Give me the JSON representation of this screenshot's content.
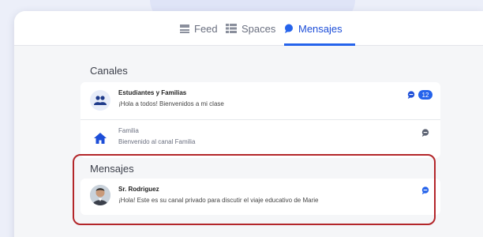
{
  "nav": {
    "tabs": [
      {
        "label": "Feed",
        "icon": "feed-icon"
      },
      {
        "label": "Spaces",
        "icon": "spaces-icon"
      },
      {
        "label": "Mensajes",
        "icon": "chat-bubble-icon",
        "active": true
      }
    ]
  },
  "channels": {
    "title": "Canales",
    "items": [
      {
        "name": "Estudiantes y Familias",
        "preview": "¡Hola a todos! Bienvenidos a mi clase",
        "unread_count": "12",
        "icon": "group-icon"
      },
      {
        "name": "Familia",
        "preview": "Bienvenido al canal Familia",
        "icon": "house-icon"
      }
    ]
  },
  "messages": {
    "title": "Mensajes",
    "items": [
      {
        "name": "Sr. Rodriguez",
        "preview": "¡Hola! Este es su canal privado para discutir el viaje educativo de Marie",
        "icon": "person-photo"
      }
    ]
  },
  "colors": {
    "accent": "#2563eb",
    "highlight_border": "#b3262a",
    "muted_icon": "#5b6272"
  }
}
